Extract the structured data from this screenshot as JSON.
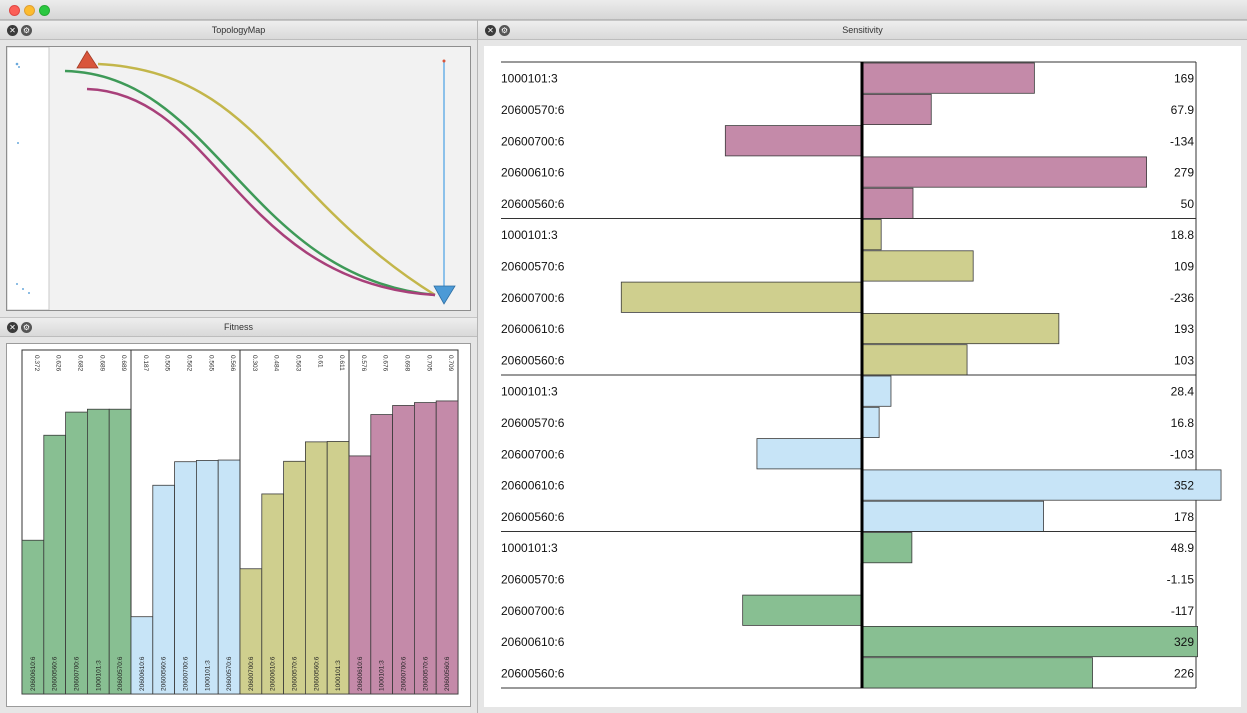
{
  "window": {
    "title": ""
  },
  "panels": {
    "topology": {
      "title": "TopologyMap"
    },
    "fitness": {
      "title": "Fitness"
    },
    "sensitivity": {
      "title": "Sensitivity"
    }
  },
  "icons": {
    "close": "close-icon",
    "settings": "settings-icon"
  },
  "colors": {
    "green": "#88bf92",
    "blue": "#c7e4f7",
    "olive": "#cfcf8e",
    "pink": "#c48aa9",
    "arrow_red": "#d9553b",
    "arrow_blue": "#4c9ad6",
    "curve_olive": "#c3b64a",
    "curve_green": "#3e9a58",
    "curve_pink": "#a8407a"
  },
  "fitness": {
    "groups": [
      {
        "color": "green",
        "values": [
          0.372,
          0.626,
          0.682,
          0.689,
          0.689
        ],
        "value_labels": [
          "0.372",
          "0.626",
          "0.682",
          "0.689",
          "0.689"
        ],
        "labels": [
          "20600610:6",
          "20600560:6",
          "20600700:6",
          "1000101:3",
          "20600570:6"
        ]
      },
      {
        "color": "blue",
        "values": [
          0.187,
          0.505,
          0.562,
          0.565,
          0.566
        ],
        "value_labels": [
          "0.187",
          "0.505",
          "0.562",
          "0.565",
          "0.566"
        ],
        "labels": [
          "20600610:6",
          "20600560:6",
          "20600700:6",
          "1000101:3",
          "20600570:6"
        ]
      },
      {
        "color": "olive",
        "values": [
          0.303,
          0.484,
          0.563,
          0.61,
          0.611
        ],
        "value_labels": [
          "0.303",
          "0.484",
          "0.563",
          "0.61",
          "0.611"
        ],
        "labels": [
          "20600700:6",
          "20600610:6",
          "20600570:6",
          "20600560:6",
          "1000101:3"
        ]
      },
      {
        "color": "pink",
        "values": [
          0.576,
          0.676,
          0.698,
          0.705,
          0.709
        ],
        "value_labels": [
          "0.576",
          "0.676",
          "0.698",
          "0.705",
          "0.709"
        ],
        "labels": [
          "20600610:6",
          "1000101:3",
          "20600700:6",
          "20600570:6",
          "20600560:6"
        ]
      }
    ]
  },
  "sensitivity": {
    "groups": [
      {
        "color": "pink",
        "rows": [
          {
            "label": "1000101:3",
            "value": 169,
            "value_label": "169"
          },
          {
            "label": "20600570:6",
            "value": 67.9,
            "value_label": "67.9"
          },
          {
            "label": "20600700:6",
            "value": -134,
            "value_label": "-134"
          },
          {
            "label": "20600610:6",
            "value": 279,
            "value_label": "279"
          },
          {
            "label": "20600560:6",
            "value": 50,
            "value_label": "50"
          }
        ]
      },
      {
        "color": "olive",
        "rows": [
          {
            "label": "1000101:3",
            "value": 18.8,
            "value_label": "18.8"
          },
          {
            "label": "20600570:6",
            "value": 109,
            "value_label": "109"
          },
          {
            "label": "20600700:6",
            "value": -236,
            "value_label": "-236"
          },
          {
            "label": "20600610:6",
            "value": 193,
            "value_label": "193"
          },
          {
            "label": "20600560:6",
            "value": 103,
            "value_label": "103"
          }
        ]
      },
      {
        "color": "blue",
        "rows": [
          {
            "label": "1000101:3",
            "value": 28.4,
            "value_label": "28.4"
          },
          {
            "label": "20600570:6",
            "value": 16.8,
            "value_label": "16.8"
          },
          {
            "label": "20600700:6",
            "value": -103,
            "value_label": "-103"
          },
          {
            "label": "20600610:6",
            "value": 352,
            "value_label": "352"
          },
          {
            "label": "20600560:6",
            "value": 178,
            "value_label": "178"
          }
        ]
      },
      {
        "color": "green",
        "rows": [
          {
            "label": "1000101:3",
            "value": 48.9,
            "value_label": "48.9"
          },
          {
            "label": "20600570:6",
            "value": -1.15,
            "value_label": "-1.15"
          },
          {
            "label": "20600700:6",
            "value": -117,
            "value_label": "-117"
          },
          {
            "label": "20600610:6",
            "value": 329,
            "value_label": "329"
          },
          {
            "label": "20600560:6",
            "value": 226,
            "value_label": "226"
          }
        ]
      }
    ]
  }
}
